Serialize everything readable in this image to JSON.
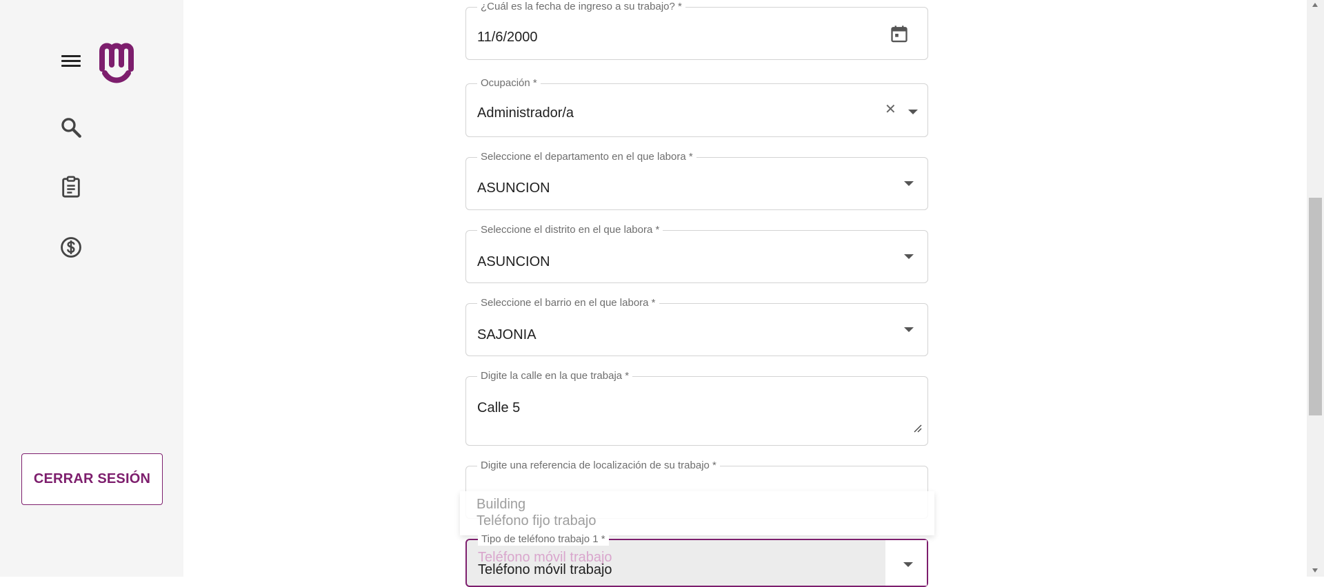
{
  "sidebar": {
    "logout_label": "CERRAR SESIÓN"
  },
  "form": {
    "fecha_ingreso": {
      "label": "¿Cuál es la fecha de ingreso a su trabajo? *",
      "value": "11/6/2000"
    },
    "ocupacion": {
      "label": "Ocupación *",
      "value": "Administrador/a"
    },
    "departamento": {
      "label": "Seleccione el departamento en el que labora *",
      "value": "ASUNCION"
    },
    "distrito": {
      "label": "Seleccione el distrito en el que labora *",
      "value": "ASUNCION"
    },
    "barrio": {
      "label": "Seleccione el barrio en el que labora *",
      "value": "SAJONIA"
    },
    "calle": {
      "label": "Digite la calle en la que trabaja *",
      "value": "Calle 5"
    },
    "referencia": {
      "label": "Digite una referencia de localización de su trabajo *"
    },
    "tipo_telefono": {
      "label": "Tipo de teléfono trabajo 1 *",
      "value": "Teléfono móvil trabajo"
    }
  },
  "dropdown": {
    "options": [
      "Building",
      "Teléfono fijo trabajo",
      "Teléfono móvil trabajo"
    ]
  },
  "colors": {
    "brand": "#7d1e6d",
    "sidebar_bg": "#f5f5f5"
  },
  "icons": [
    "menu-icon",
    "brand-logo",
    "search-icon",
    "clipboard-icon",
    "dollar-circle-icon",
    "calendar-icon",
    "close-icon",
    "chevron-down-icon",
    "resize-handle-icon"
  ]
}
